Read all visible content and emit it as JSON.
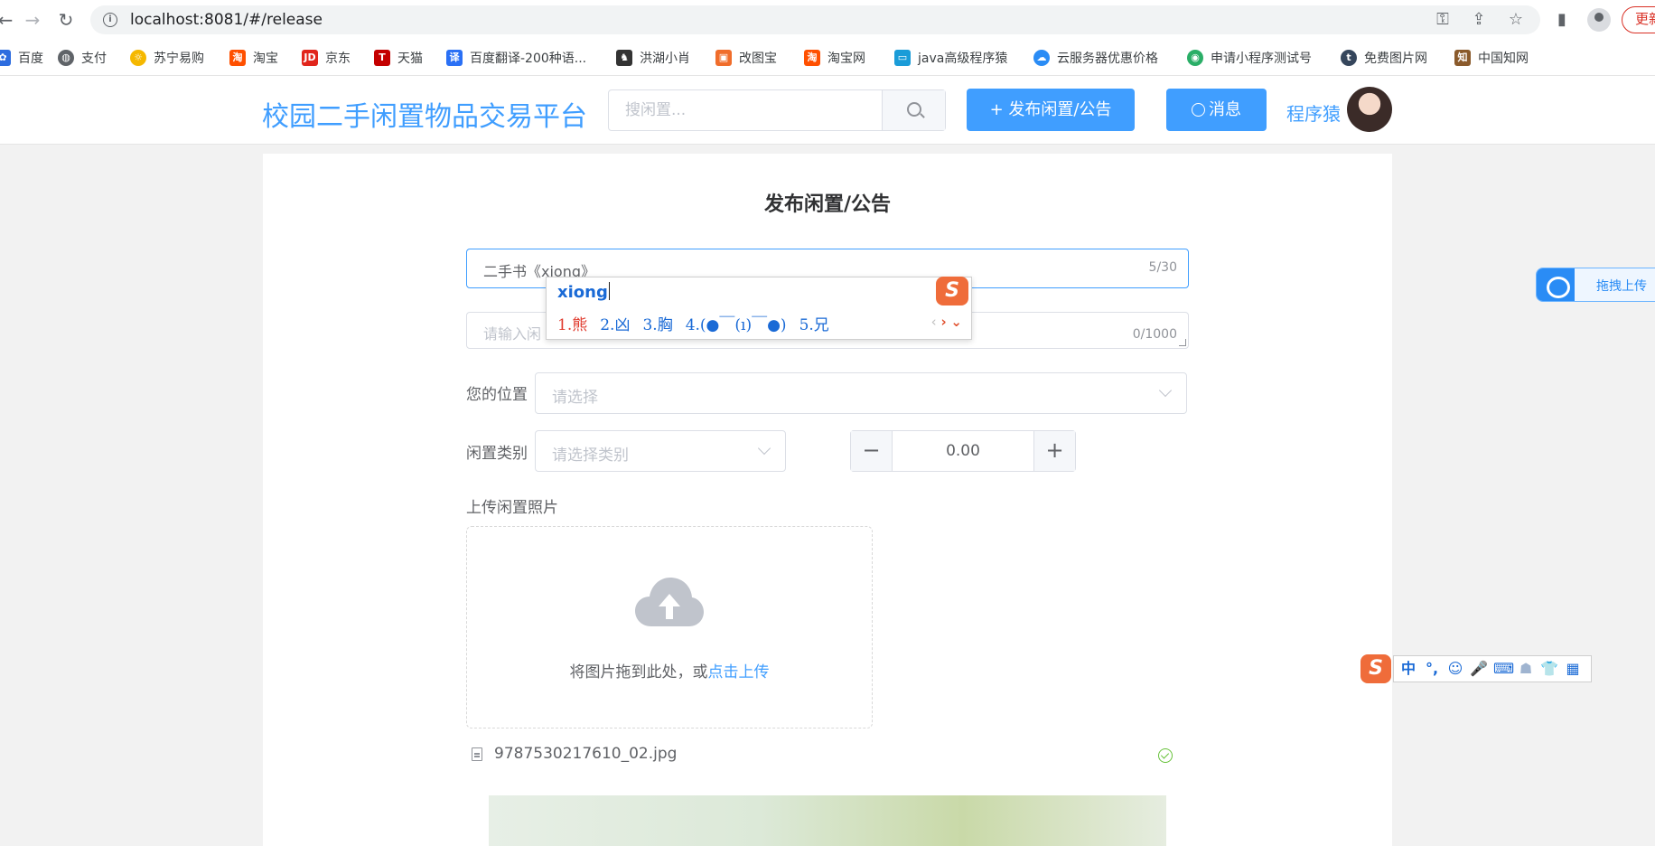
{
  "browser": {
    "url": "localhost:8081/#/release",
    "update_label": "更新"
  },
  "bookmarks": [
    {
      "label": "百度",
      "icon": "paw-icon",
      "color": "#2d6cdf"
    },
    {
      "label": "支付",
      "icon": "globe-icon",
      "color": "#5f6368"
    },
    {
      "label": "苏宁易购",
      "icon": "lion-icon",
      "color": "#f5b800"
    },
    {
      "label": "淘宝",
      "icon": "taobao-icon",
      "color": "#ff5000"
    },
    {
      "label": "京东",
      "icon": "jd-icon",
      "color": "#e1251b"
    },
    {
      "label": "天猫",
      "icon": "tmall-icon",
      "color": "#c40000"
    },
    {
      "label": "百度翻译-200种语...",
      "icon": "translate-icon",
      "color": "#2a70f5"
    },
    {
      "label": "洪湖小肖",
      "icon": "horse-icon",
      "color": "#333333"
    },
    {
      "label": "改图宝",
      "icon": "image-icon",
      "color": "#f06d2b"
    },
    {
      "label": "淘宝网",
      "icon": "taobao-icon",
      "color": "#ff5000"
    },
    {
      "label": "java高级程序猿",
      "icon": "bilibili-icon",
      "color": "#1a9cd8"
    },
    {
      "label": "云服务器优惠价格",
      "icon": "cloud-icon",
      "color": "#2a8cf5"
    },
    {
      "label": "申请小程序测试号",
      "icon": "wechat-icon",
      "color": "#2aae67"
    },
    {
      "label": "免费图片网",
      "icon": "tumblr-icon",
      "color": "#35465c"
    },
    {
      "label": "中国知网",
      "icon": "cnki-icon",
      "color": "#8a5a2b"
    }
  ],
  "header": {
    "title": "校园二手闲置物品交易平台",
    "search_placeholder": "搜闲置...",
    "publish_button": "+ 发布闲置/公告",
    "message_button": "消息",
    "username": "程序猿"
  },
  "form": {
    "heading": "发布闲置/公告",
    "title_value": "二手书《xiong》",
    "title_count": "5/30",
    "desc_placeholder": "请输入闲",
    "desc_count": "0/1000",
    "location_label": "您的位置",
    "location_placeholder": "请选择",
    "category_label": "闲置类别",
    "category_placeholder": "请选择类别",
    "price_value": "0.00",
    "photo_label": "上传闲置照片",
    "upload_text": "将图片拖到此处，或",
    "upload_link": "点击上传",
    "file_name": "9787530217610_02.jpg"
  },
  "ime": {
    "composition": "xiong",
    "candidates": [
      "1.熊",
      "2.凶",
      "3.胸",
      "4.(●￣(ı)￣●)",
      "5.兄"
    ],
    "logo": "S"
  },
  "drag_upload": {
    "label": "拖拽上传"
  },
  "ime_toolbar": {
    "items": [
      "中",
      "°,",
      "☺",
      "🎤",
      "⌨",
      "☗",
      "👕",
      "▦"
    ]
  },
  "colors": {
    "primary": "#409eff",
    "success": "#67c23a",
    "ime_candidate": "#1a6ad6",
    "ime_first": "#e03b2e"
  }
}
